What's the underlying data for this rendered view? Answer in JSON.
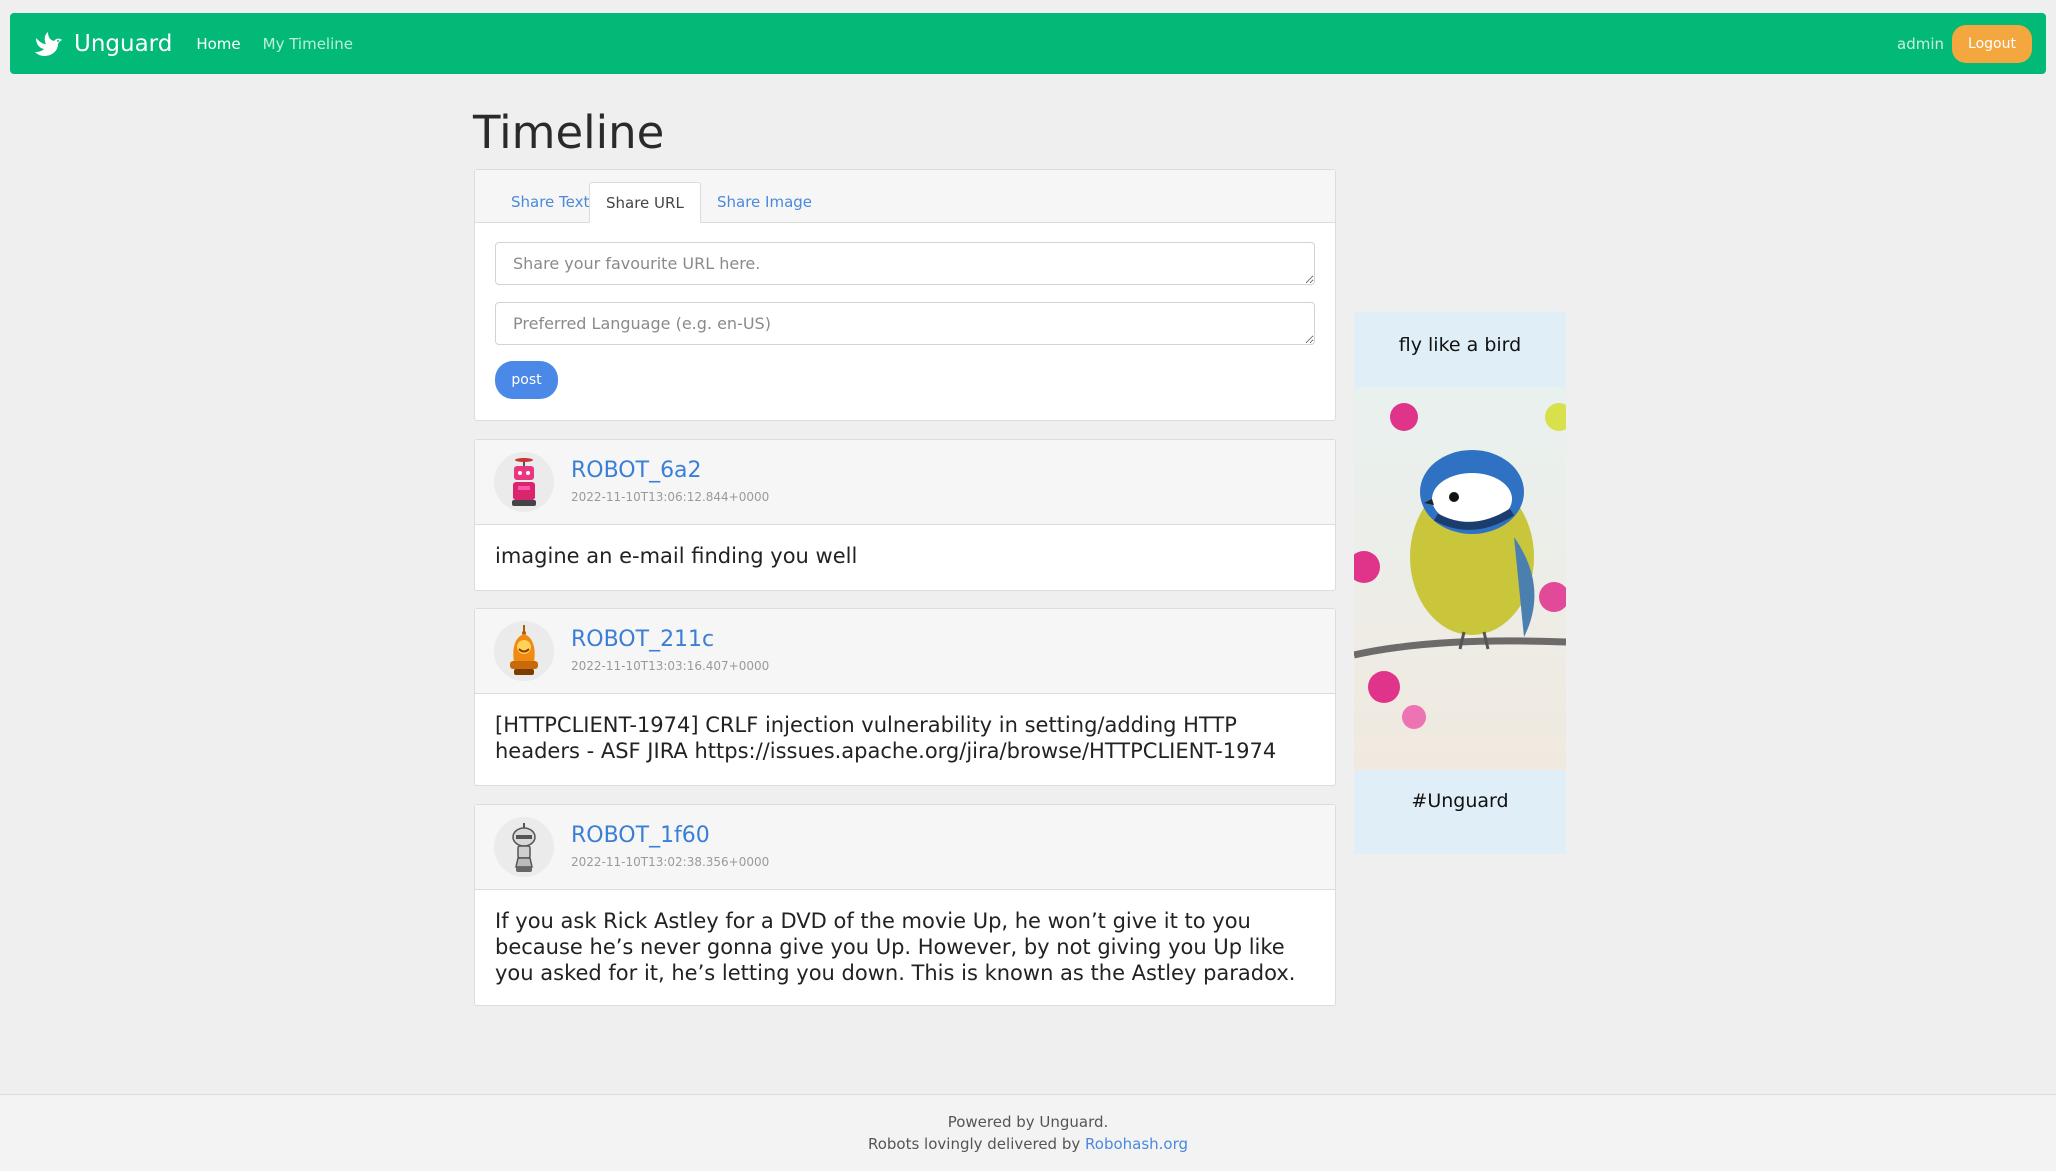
{
  "navbar": {
    "brand": "Unguard",
    "home": "Home",
    "my_timeline": "My Timeline",
    "user": "admin",
    "logout": "Logout",
    "colors": {
      "bar": "#03b977",
      "logout": "#f5a73f"
    }
  },
  "main": {
    "title": "Timeline",
    "tabs": [
      {
        "label": "Share Text"
      },
      {
        "label": "Share URL"
      },
      {
        "label": "Share Image"
      }
    ],
    "active_tab": "Share URL",
    "url_placeholder": "Share your favourite URL here.",
    "lang_placeholder": "Preferred Language (e.g. en-US)",
    "post_button": "post"
  },
  "posts": [
    {
      "user": "ROBOT_6a2",
      "time": "2022-11-10T13:06:12.844+0000",
      "body": "imagine an e-mail finding you well"
    },
    {
      "user": "ROBOT_211c",
      "time": "2022-11-10T13:03:16.407+0000",
      "body": "[HTTPCLIENT-1974] CRLF injection vulnerability in setting/adding HTTP headers - ASF JIRA https://issues.apache.org/jira/browse/HTTPCLIENT-1974"
    },
    {
      "user": "ROBOT_1f60",
      "time": "2022-11-10T13:02:38.356+0000",
      "body": "If you ask Rick Astley for a DVD of the movie Up, he won’t give it to you because he’s never gonna give you Up. However, by not giving you Up like you asked for it, he’s letting you down. This is known as the Astley paradox."
    }
  ],
  "ad": {
    "top_text": "fly like a bird",
    "bottom_text": "#Unguard",
    "image": "blue-tit-bird-photo"
  },
  "footer": {
    "line1": "Powered by Unguard.",
    "line2_prefix": "Robots lovingly delivered by",
    "line2_link": "Robohash.org"
  }
}
